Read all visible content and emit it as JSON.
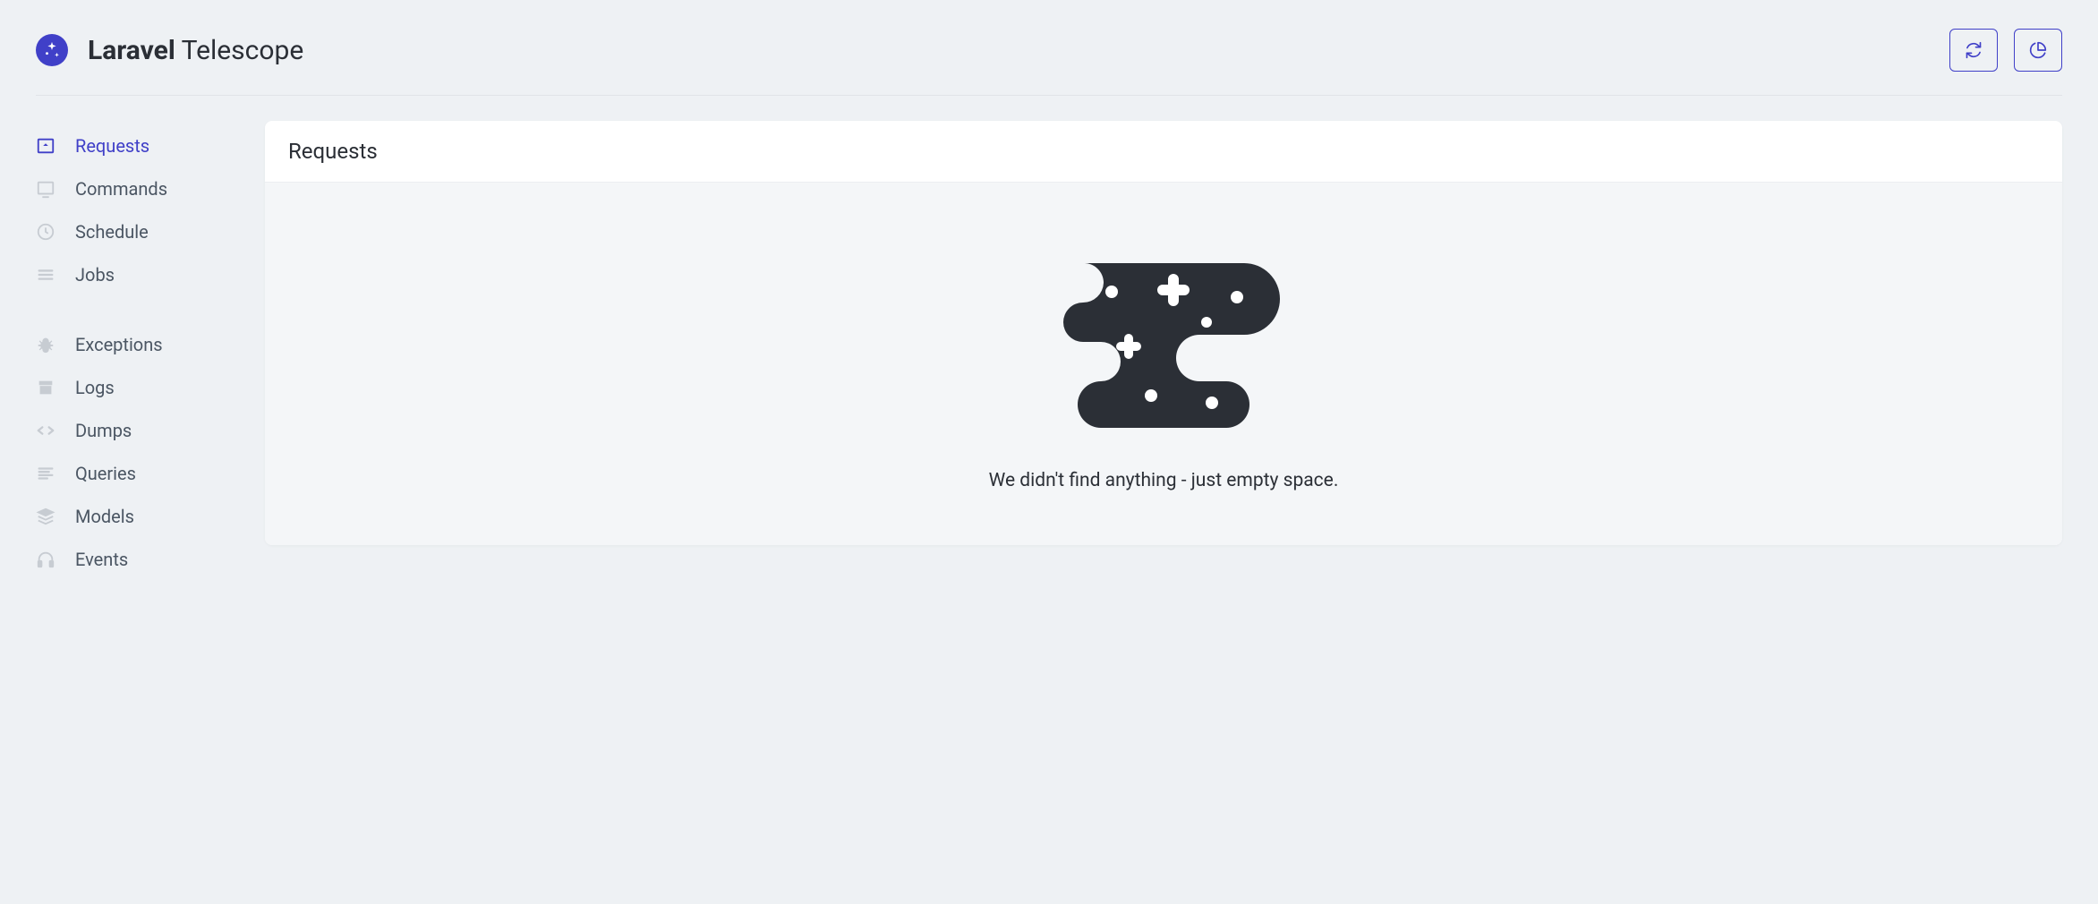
{
  "brand": {
    "bold": "Laravel",
    "light": " Telescope"
  },
  "header_actions": {
    "refresh": "Refresh",
    "stats": "Stats"
  },
  "sidebar": {
    "group1": [
      {
        "label": "Requests",
        "icon": "request",
        "active": true
      },
      {
        "label": "Commands",
        "icon": "terminal",
        "active": false
      },
      {
        "label": "Schedule",
        "icon": "clock",
        "active": false
      },
      {
        "label": "Jobs",
        "icon": "list",
        "active": false
      }
    ],
    "group2": [
      {
        "label": "Exceptions",
        "icon": "bug",
        "active": false
      },
      {
        "label": "Logs",
        "icon": "archive",
        "active": false
      },
      {
        "label": "Dumps",
        "icon": "code",
        "active": false
      },
      {
        "label": "Queries",
        "icon": "lines",
        "active": false
      },
      {
        "label": "Models",
        "icon": "layers",
        "active": false
      },
      {
        "label": "Events",
        "icon": "headphones",
        "active": false
      }
    ]
  },
  "main": {
    "title": "Requests",
    "empty_message": "We didn't find anything - just empty space."
  }
}
